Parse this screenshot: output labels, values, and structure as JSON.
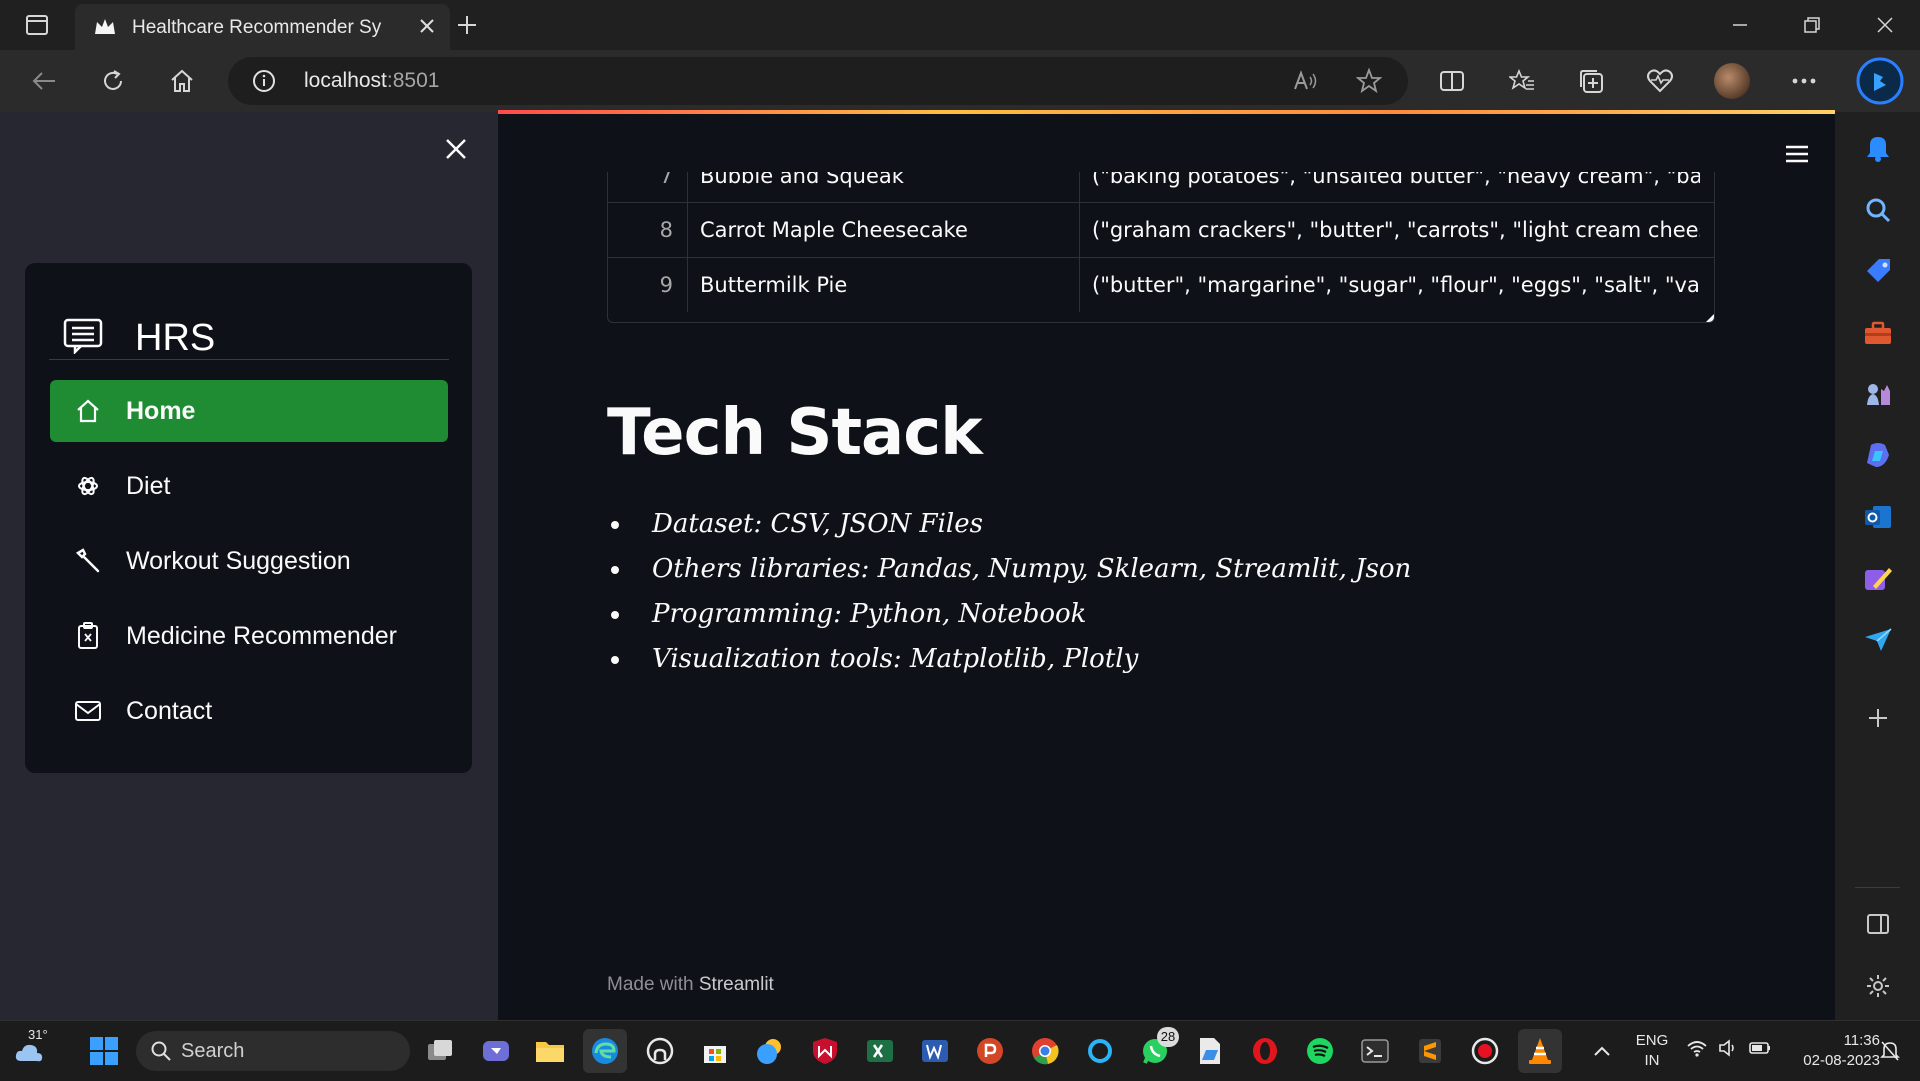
{
  "browser": {
    "tab_title": "Healthcare Recommender System",
    "address_host": "localhost",
    "address_port": ":8501"
  },
  "sidebar": {
    "brand": "HRS",
    "items": [
      {
        "label": "Home",
        "icon": "house-icon",
        "active": true
      },
      {
        "label": "Diet",
        "icon": "diet-icon",
        "active": false
      },
      {
        "label": "Workout Suggestion",
        "icon": "wrench-icon",
        "active": false
      },
      {
        "label": "Medicine Recommender",
        "icon": "clipboard-icon",
        "active": false
      },
      {
        "label": "Contact",
        "icon": "envelope-icon",
        "active": false
      }
    ]
  },
  "table": {
    "rows": [
      {
        "index": "7",
        "name": "Bubble and Squeak",
        "ingredients": "(\"baking potatoes\", \"unsalted butter\", \"heavy cream\", \"bacon\", \"onio"
      },
      {
        "index": "8",
        "name": "Carrot Maple Cheesecake",
        "ingredients": "(\"graham crackers\", \"butter\", \"carrots\", \"light cream cheese\", \"granu"
      },
      {
        "index": "9",
        "name": "Buttermilk Pie",
        "ingredients": "(\"butter\", \"margarine\", \"sugar\", \"flour\", \"eggs\", \"salt\", \"vanilla\", \"but"
      }
    ]
  },
  "content": {
    "heading": "Tech Stack",
    "bullets": [
      "Dataset: CSV, JSON Files",
      "Others libraries: Pandas, Numpy, Sklearn, Streamlit, Json",
      "Programming: Python, Notebook",
      "Visualization tools: Matplotlib, Plotly"
    ],
    "footer_prefix": "Made with ",
    "footer_brand": "Streamlit"
  },
  "taskbar": {
    "weather_temp": "31°",
    "search_label": "Search",
    "whatsapp_badge": "28",
    "lang_top": "ENG",
    "lang_bottom": "IN",
    "time": "11:36",
    "date": "02-08-2023"
  },
  "colors": {
    "accent_green": "#1f8b33",
    "app_bg": "#0e1117",
    "sidebar_bg": "#262730"
  }
}
